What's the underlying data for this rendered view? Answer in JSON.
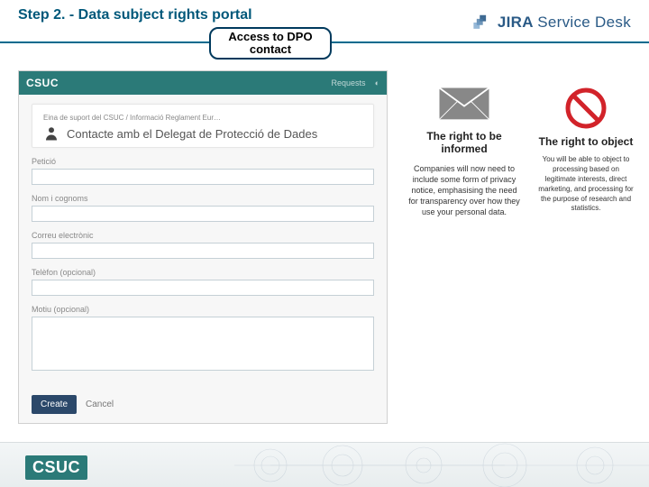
{
  "header": {
    "title": "Step 2. - Data subject rights portal",
    "product_name": "JIRA",
    "product_suffix": "Service Desk"
  },
  "callout": {
    "label": "Access to DPO contact"
  },
  "portal": {
    "brand": "CSUC",
    "nav_requests": "Requests",
    "breadcrumb": "Eina de suport del CSUC  /  Informació Reglament Eur…",
    "card_title": "Contacte amb el Delegat de Protecció de Dades",
    "fields": {
      "peticio": "Petició",
      "nom": "Nom i cognoms",
      "correu": "Correu electrònic",
      "telefon": "Telèfon (opcional)",
      "motiu": "Motiu (opcional)"
    },
    "actions": {
      "create": "Create",
      "cancel": "Cancel"
    }
  },
  "rights": {
    "informed": {
      "title": "The right to be informed",
      "body": "Companies will now need to include some form of privacy notice, emphasising the need for transparency over how they use your personal data."
    },
    "object": {
      "title": "The right to object",
      "body": "You will be able to object to processing based on legitimate interests, direct marketing, and processing for the purpose of research and statistics."
    }
  },
  "footer": {
    "brand": "CSUC"
  }
}
